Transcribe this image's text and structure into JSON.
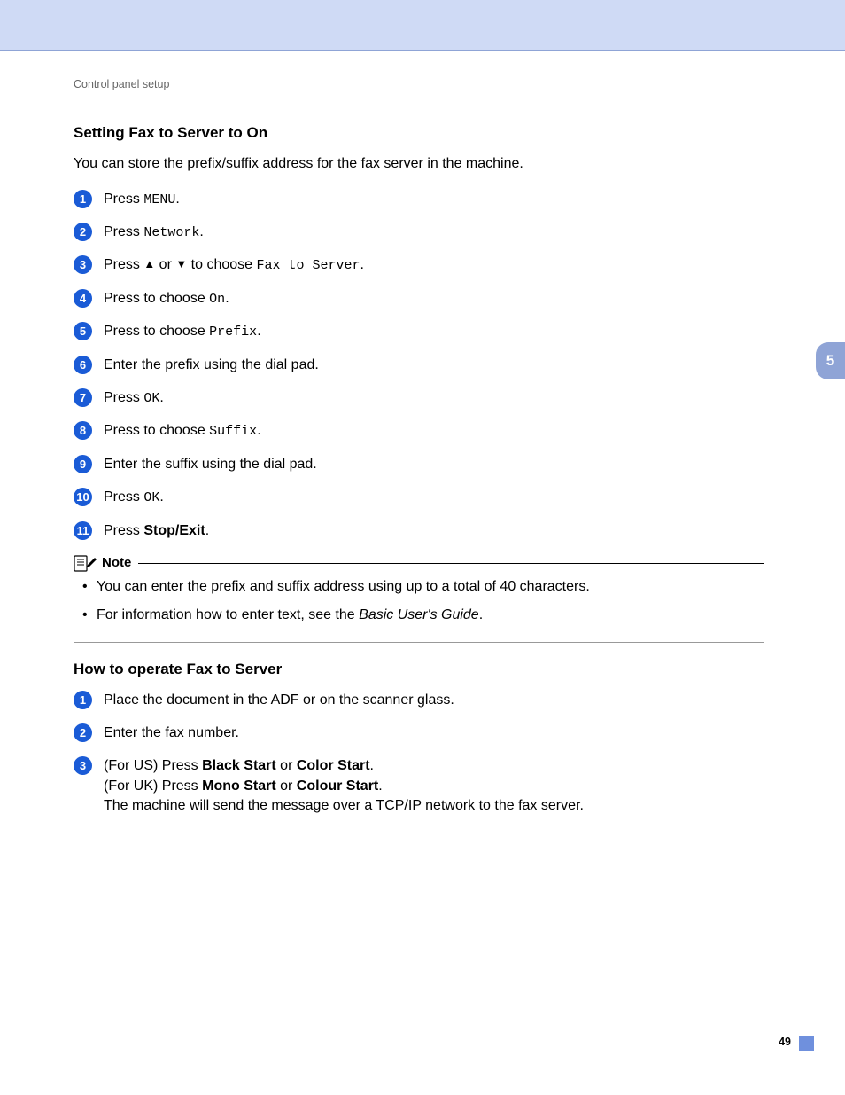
{
  "breadcrumb": "Control panel setup",
  "chapter_number": "5",
  "page_number": "49",
  "section1": {
    "title": "Setting Fax to Server to On",
    "intro": "You can store the prefix/suffix address for the fax server in the machine.",
    "steps": {
      "s1_a": "Press ",
      "s1_menu": "MENU",
      "s1_b": ".",
      "s2_a": "Press ",
      "s2_net": "Network",
      "s2_b": ".",
      "s3_a": "Press ",
      "s3_up": "▲",
      "s3_or": " or ",
      "s3_down": "▼",
      "s3_b": " to choose ",
      "s3_fts": "Fax to Server",
      "s3_c": ".",
      "s4_a": "Press to choose ",
      "s4_on": "On",
      "s4_b": ".",
      "s5_a": "Press to choose ",
      "s5_prefix": "Prefix",
      "s5_b": ".",
      "s6": "Enter the prefix using the dial pad.",
      "s7_a": "Press ",
      "s7_ok": "OK",
      "s7_b": ".",
      "s8_a": "Press to choose ",
      "s8_suffix": "Suffix",
      "s8_b": ".",
      "s9": "Enter the suffix using the dial pad.",
      "s10_a": "Press ",
      "s10_ok": "OK",
      "s10_b": ".",
      "s11_a": "Press ",
      "s11_stop": "Stop/Exit",
      "s11_b": "."
    },
    "note_label": "Note",
    "note1": "You can enter the prefix and suffix address using up to a total of 40 characters.",
    "note2_a": "For information how to enter text, see the ",
    "note2_i": "Basic User's Guide",
    "note2_b": "."
  },
  "section2": {
    "title": "How to operate Fax to Server",
    "steps": {
      "s1": "Place the document in the ADF or on the scanner glass.",
      "s2": "Enter the fax number.",
      "s3_a": "(For US) Press ",
      "s3_bs": "Black Start",
      "s3_or1": " or ",
      "s3_cs": "Color Start",
      "s3_p1": ".",
      "s3_b": "(For UK) Press ",
      "s3_ms": "Mono Start",
      "s3_or2": " or ",
      "s3_cls": "Colour Start",
      "s3_p2": ".",
      "s3_c": "The machine will send the message over a TCP/IP network to the fax server."
    }
  }
}
